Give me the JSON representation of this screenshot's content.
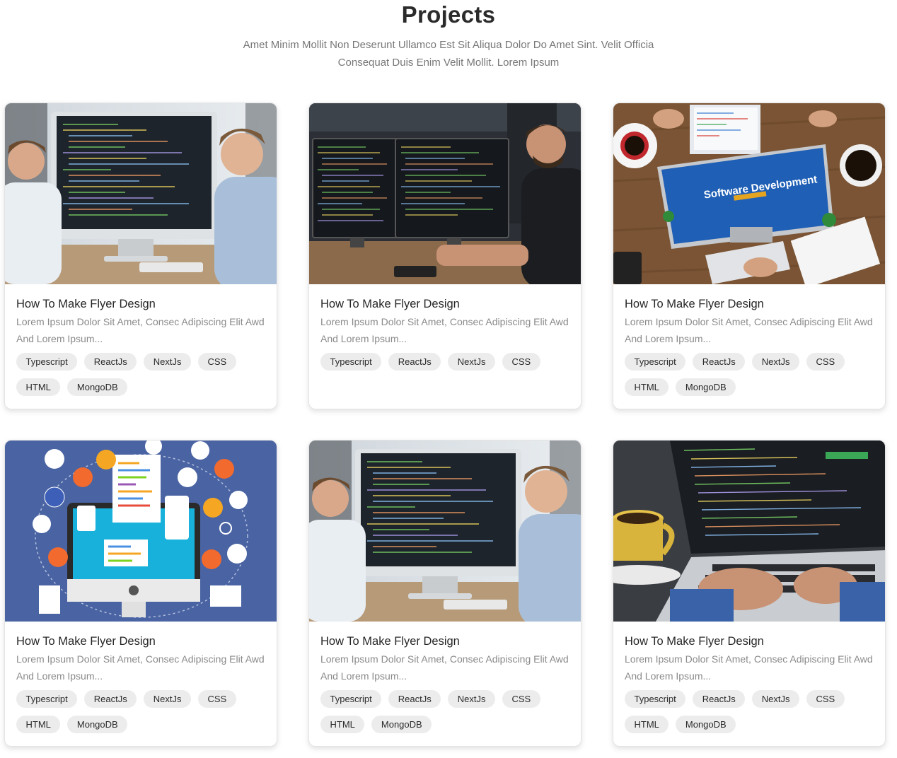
{
  "header": {
    "title": "Projects",
    "subtitle_line1": "Amet Minim Mollit Non Deserunt Ullamco Est Sit Aliqua Dolor Do Amet Sint. Velit Officia",
    "subtitle_line2": "Consequat Duis Enim Velit Mollit. Lorem Ipsum"
  },
  "cards": [
    {
      "image": "two-developers-at-monitor-photo",
      "title": "How To Make Flyer Design",
      "description": "Lorem Ipsum Dolor Sit Amet, Consec Adipiscing Elit Awd And Lorem Ipsum...",
      "tags": [
        "Typescript",
        "ReactJs",
        "NextJs",
        "CSS",
        "HTML",
        "MongoDB"
      ]
    },
    {
      "image": "developer-dual-monitors-photo",
      "title": "How To Make Flyer Design",
      "description": "Lorem Ipsum Dolor Sit Amet, Consec Adipiscing Elit Awd And Lorem Ipsum...",
      "tags": [
        "Typescript",
        "ReactJs",
        "NextJs",
        "CSS"
      ]
    },
    {
      "image": "software-development-desk-photo",
      "image_text": "Software Development",
      "title": "How To Make Flyer Design",
      "description": "Lorem Ipsum Dolor Sit Amet, Consec Adipiscing Elit Awd And Lorem Ipsum...",
      "tags": [
        "Typescript",
        "ReactJs",
        "NextJs",
        "CSS",
        "HTML",
        "MongoDB"
      ]
    },
    {
      "image": "computer-app-icons-illustration",
      "title": "How To Make Flyer Design",
      "description": "Lorem Ipsum Dolor Sit Amet, Consec Adipiscing Elit Awd And Lorem Ipsum...",
      "tags": [
        "Typescript",
        "ReactJs",
        "NextJs",
        "CSS",
        "HTML",
        "MongoDB"
      ]
    },
    {
      "image": "two-developers-at-monitor-photo",
      "title": "How To Make Flyer Design",
      "description": "Lorem Ipsum Dolor Sit Amet, Consec Adipiscing Elit Awd And Lorem Ipsum...",
      "tags": [
        "Typescript",
        "ReactJs",
        "NextJs",
        "CSS",
        "HTML",
        "MongoDB"
      ]
    },
    {
      "image": "laptop-code-coffee-photo",
      "title": "How To Make Flyer Design",
      "description": "Lorem Ipsum Dolor Sit Amet, Consec Adipiscing Elit Awd And Lorem Ipsum...",
      "tags": [
        "Typescript",
        "ReactJs",
        "NextJs",
        "CSS",
        "HTML",
        "MongoDB"
      ]
    }
  ],
  "colors": {
    "title": "#2b2b2b",
    "subtitle": "#777777",
    "tag_bg": "#ececec",
    "card_border": "#e4e4e4",
    "illustration_bg": "#4a64a3"
  }
}
